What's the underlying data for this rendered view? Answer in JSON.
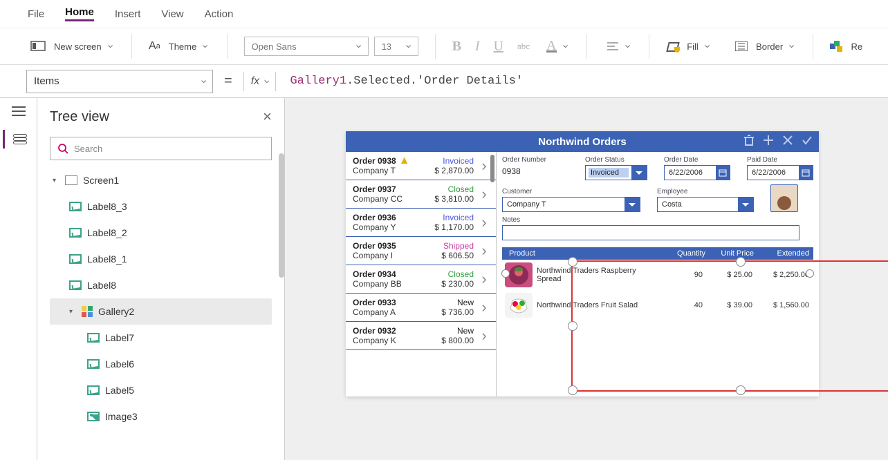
{
  "menu": {
    "items": [
      "File",
      "Home",
      "Insert",
      "View",
      "Action"
    ],
    "active": "Home"
  },
  "ribbon": {
    "newScreen": "New screen",
    "theme": "Theme",
    "font": "Open Sans",
    "size": "13",
    "fill": "Fill",
    "border": "Border",
    "reorder": "Re"
  },
  "formula": {
    "property": "Items",
    "fx": "fx",
    "ident": "Gallery1",
    "rest": ".Selected.'Order Details'"
  },
  "tree": {
    "title": "Tree view",
    "searchPlaceholder": "Search",
    "nodes": {
      "screen": "Screen1",
      "label8_3": "Label8_3",
      "label8_2": "Label8_2",
      "label8_1": "Label8_1",
      "label8": "Label8",
      "gallery2": "Gallery2",
      "label7": "Label7",
      "label6": "Label6",
      "label5": "Label5",
      "image3": "Image3"
    }
  },
  "app": {
    "title": "Northwind Orders",
    "orders": [
      {
        "id": "Order 0938",
        "company": "Company T",
        "status": "Invoiced",
        "statusCls": "st-invoiced",
        "amount": "$ 2,870.00",
        "warn": true
      },
      {
        "id": "Order 0937",
        "company": "Company CC",
        "status": "Closed",
        "statusCls": "st-closed",
        "amount": "$ 3,810.00",
        "warn": false
      },
      {
        "id": "Order 0936",
        "company": "Company Y",
        "status": "Invoiced",
        "statusCls": "st-invoiced",
        "amount": "$ 1,170.00",
        "warn": false
      },
      {
        "id": "Order 0935",
        "company": "Company I",
        "status": "Shipped",
        "statusCls": "st-shipped",
        "amount": "$ 606.50",
        "warn": false
      },
      {
        "id": "Order 0934",
        "company": "Company BB",
        "status": "Closed",
        "statusCls": "st-closed",
        "amount": "$ 230.00",
        "warn": false
      },
      {
        "id": "Order 0933",
        "company": "Company A",
        "status": "New",
        "statusCls": "st-new",
        "amount": "$ 736.00",
        "warn": false
      },
      {
        "id": "Order 0932",
        "company": "Company K",
        "status": "New",
        "statusCls": "st-new",
        "amount": "$ 800.00",
        "warn": false
      }
    ],
    "detail": {
      "labels": {
        "orderNumber": "Order Number",
        "orderStatus": "Order Status",
        "orderDate": "Order Date",
        "paidDate": "Paid Date",
        "customer": "Customer",
        "employee": "Employee",
        "notes": "Notes"
      },
      "orderNumber": "0938",
      "orderStatus": "Invoiced",
      "orderDate": "6/22/2006",
      "paidDate": "6/22/2006",
      "customer": "Company T",
      "employee": "Costa"
    },
    "grid": {
      "headers": {
        "product": "Product",
        "qty": "Quantity",
        "unit": "Unit Price",
        "ext": "Extended"
      },
      "rows": [
        {
          "product": "Northwind Traders Raspberry Spread",
          "qty": "90",
          "unit": "$ 25.00",
          "ext": "$ 2,250.00"
        },
        {
          "product": "Northwind Traders Fruit Salad",
          "qty": "40",
          "unit": "$ 39.00",
          "ext": "$ 1,560.00"
        }
      ]
    }
  }
}
